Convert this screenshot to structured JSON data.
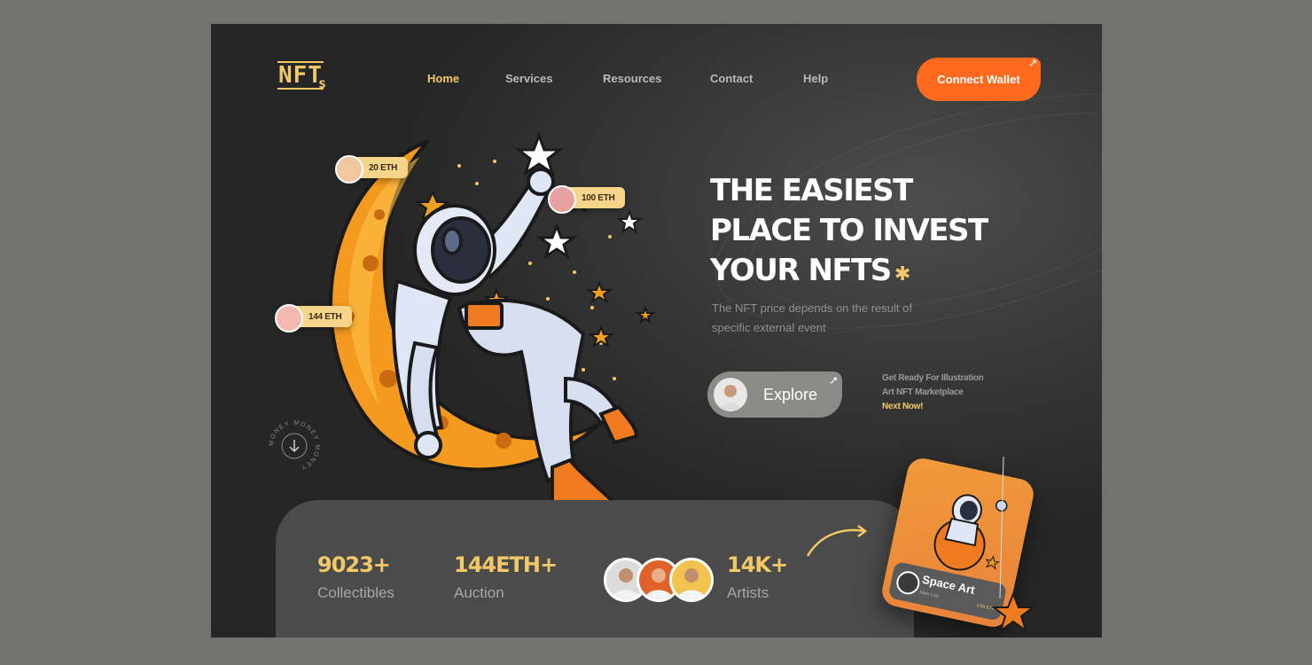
{
  "nav": {
    "logo": "NFT",
    "logo_sub": "s",
    "items": [
      "Home",
      "Services",
      "Resources",
      "Contact",
      "Help"
    ],
    "active": "Home",
    "cta_label": "Connect Wallet"
  },
  "hero": {
    "title_lines": [
      "THE EASIEST",
      "PLACE TO INVEST",
      "YOUR NFTS"
    ],
    "subtitle": "The NFT price depends on the result of specific external event",
    "explore_label": "Explore",
    "note_line1": "Get Ready For Illustration",
    "note_line2": "Art NFT Marketplace",
    "note_highlight": "Next Now!"
  },
  "badges": [
    {
      "label": "20 ETH"
    },
    {
      "label": "100 ETH"
    },
    {
      "label": "144 ETH"
    }
  ],
  "scroll_text": "MONEY MONEY MONEY",
  "stats": [
    {
      "value": "9023+",
      "label": "Collectibles"
    },
    {
      "value": "144ETH+",
      "label": "Auction"
    },
    {
      "value": "14K+",
      "label": "Artists"
    }
  ],
  "card": {
    "title": "Space Art",
    "author": "Mark Lost",
    "price": "3.60 ETH"
  },
  "colors": {
    "accent": "#f3c968",
    "cta": "#ff6a1f",
    "background": "#2e2e2e"
  }
}
